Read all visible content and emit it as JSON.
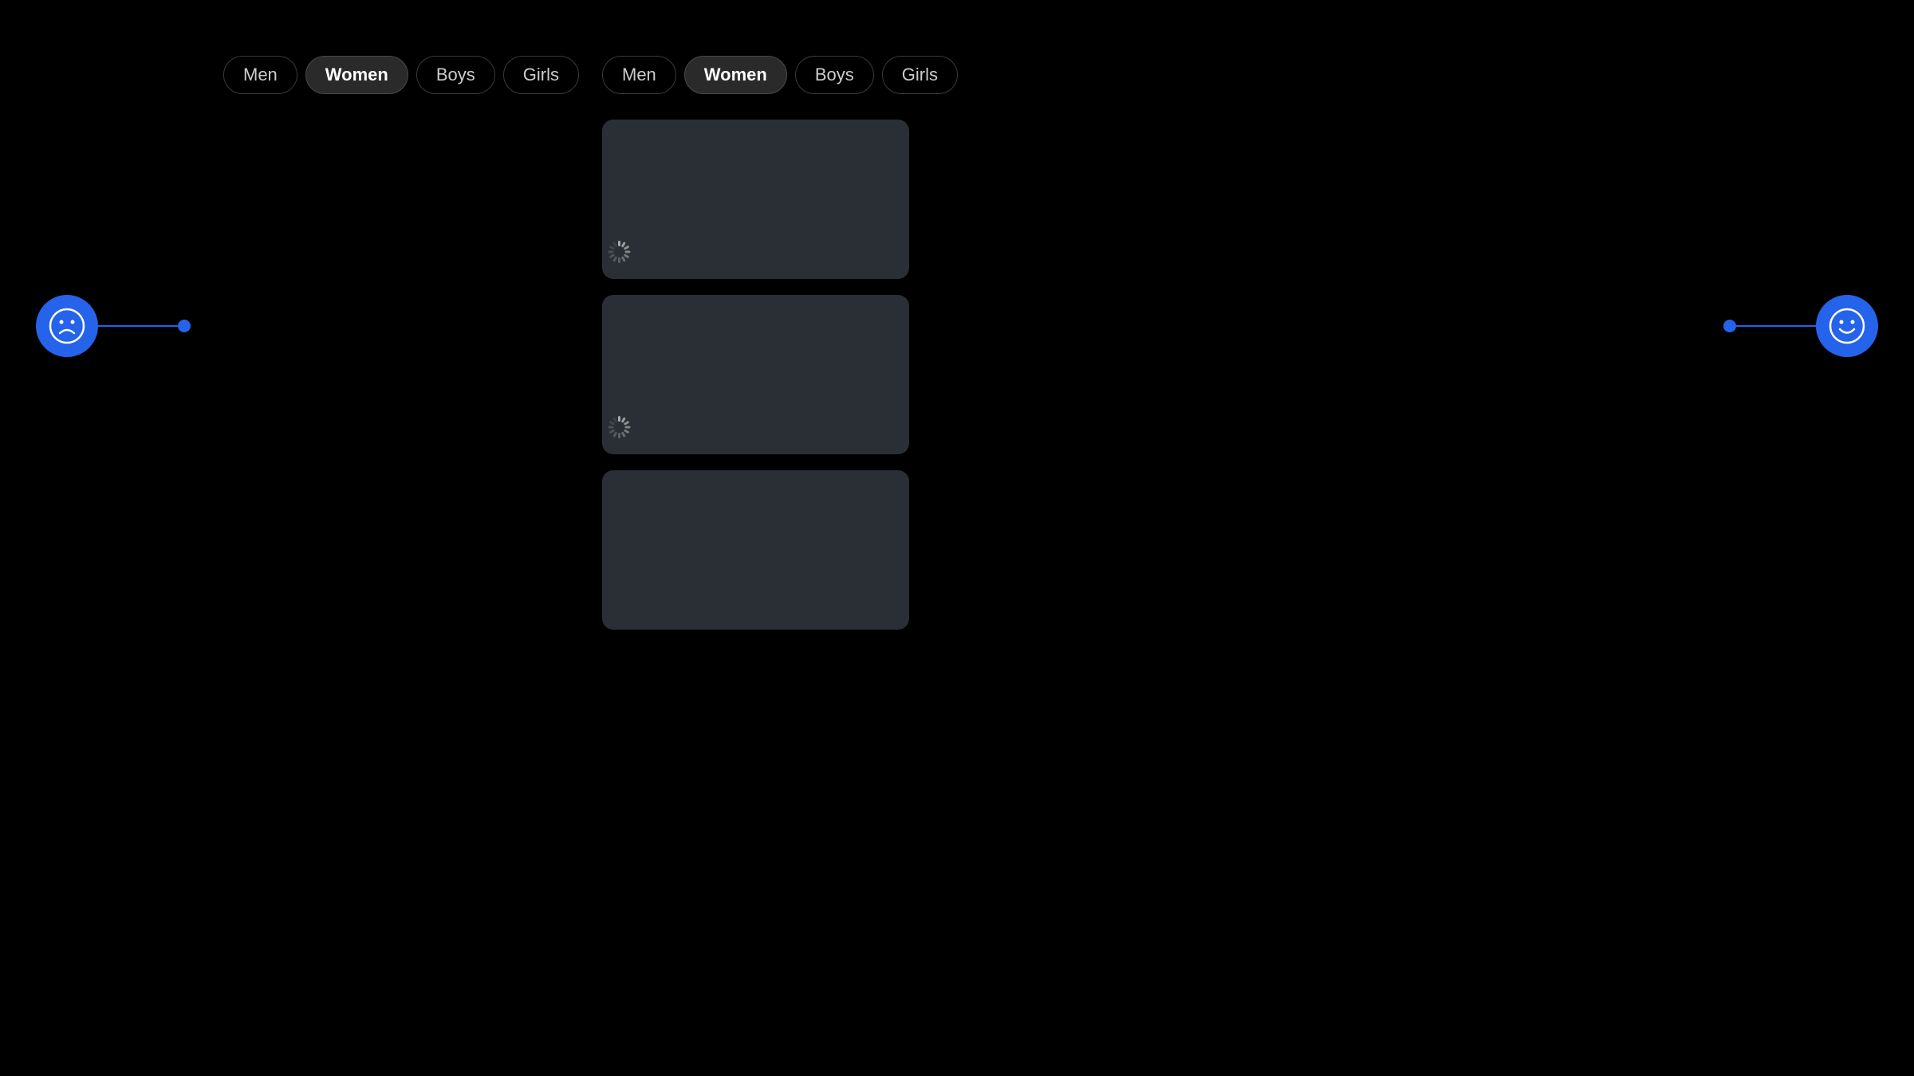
{
  "tabs_left": {
    "items": [
      {
        "label": "Men",
        "active": false
      },
      {
        "label": "Women",
        "active": true
      },
      {
        "label": "Boys",
        "active": false
      },
      {
        "label": "Girls",
        "active": false
      }
    ]
  },
  "tabs_right": {
    "items": [
      {
        "label": "Men",
        "active": false
      },
      {
        "label": "Women",
        "active": true
      },
      {
        "label": "Boys",
        "active": false
      },
      {
        "label": "Girls",
        "active": false
      }
    ]
  },
  "cards": [
    {
      "id": 1,
      "has_spinner": true
    },
    {
      "id": 2,
      "has_spinner": true
    },
    {
      "id": 3,
      "has_spinner": false
    }
  ],
  "sentiment_left": {
    "type": "sad",
    "label": "sad-face-icon"
  },
  "sentiment_right": {
    "type": "happy",
    "label": "happy-face-icon"
  },
  "colors": {
    "accent": "#2563eb",
    "card_bg": "#2a2f35",
    "tab_active_bg": "#2a2a2a",
    "background": "#000000"
  }
}
